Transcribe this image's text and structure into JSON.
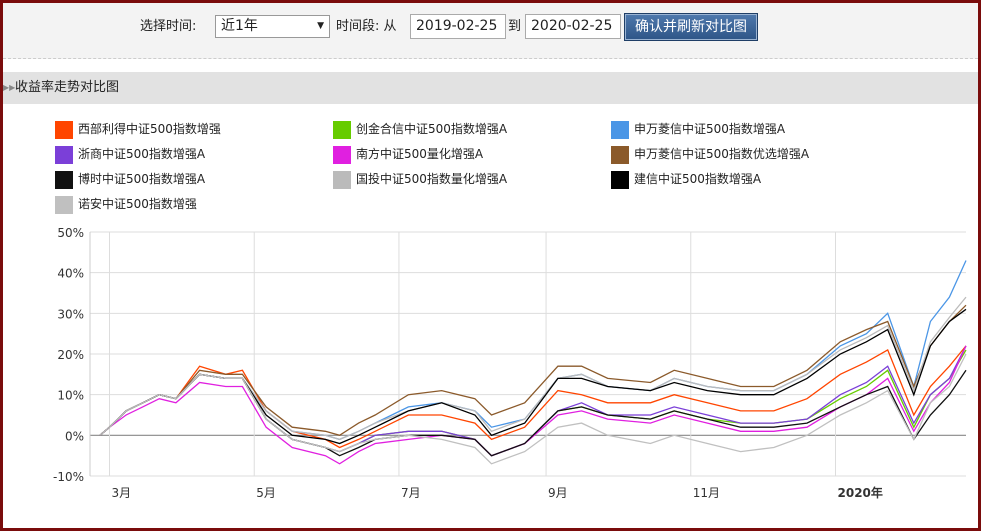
{
  "toolbar": {
    "select_time_label": "选择时间:",
    "range_value": "近1年",
    "period_label": "时间段: 从",
    "start_date": "2019-02-25",
    "to_label": "到",
    "end_date": "2020-02-25",
    "confirm_button": "确认并刷新对比图"
  },
  "section": {
    "title": "收益率走势对比图",
    "icon": "double-chevron-right-icon"
  },
  "chart_data": {
    "type": "line",
    "title": "",
    "xlabel": "",
    "ylabel": "",
    "ylim": [
      -10,
      50
    ],
    "y_ticks": [
      "50%",
      "40%",
      "30%",
      "20%",
      "10%",
      "0%",
      "-10%"
    ],
    "y_tick_values": [
      50,
      40,
      30,
      20,
      10,
      0,
      -10
    ],
    "x_ticks": [
      {
        "label": "3月",
        "date": "2019-03-01"
      },
      {
        "label": "5月",
        "date": "2019-05-01"
      },
      {
        "label": "7月",
        "date": "2019-07-01"
      },
      {
        "label": "9月",
        "date": "2019-09-01"
      },
      {
        "label": "11月",
        "date": "2019-11-01"
      },
      {
        "label": "2020年",
        "date": "2020-01-01",
        "bold": true
      }
    ],
    "xlim": [
      "2019-02-25",
      "2020-02-25"
    ],
    "grid": true,
    "legend_placement": "top",
    "dates": [
      "2019-02-25",
      "2019-03-01",
      "2019-03-08",
      "2019-03-15",
      "2019-03-22",
      "2019-03-29",
      "2019-04-08",
      "2019-04-19",
      "2019-04-26",
      "2019-05-06",
      "2019-05-17",
      "2019-05-31",
      "2019-06-06",
      "2019-06-14",
      "2019-06-21",
      "2019-07-05",
      "2019-07-19",
      "2019-08-02",
      "2019-08-09",
      "2019-08-23",
      "2019-09-06",
      "2019-09-16",
      "2019-09-27",
      "2019-10-15",
      "2019-10-25",
      "2019-11-08",
      "2019-11-22",
      "2019-12-06",
      "2019-12-20",
      "2020-01-03",
      "2020-01-14",
      "2020-01-23",
      "2020-02-03",
      "2020-02-10",
      "2020-02-18",
      "2020-02-25"
    ],
    "series": [
      {
        "name": "西部利得中证500指数增强",
        "color": "#ff4500",
        "values": [
          0,
          2,
          6,
          8,
          10,
          9,
          17,
          15,
          16,
          6,
          1,
          -1,
          -3,
          -1,
          1,
          5,
          5,
          3,
          -1,
          2,
          11,
          10,
          8,
          8,
          10,
          8,
          6,
          6,
          9,
          15,
          18,
          21,
          5,
          12,
          17,
          22
        ]
      },
      {
        "name": "创金合信中证500指数增强A",
        "color": "#66cc00",
        "values": [
          0,
          2,
          6,
          8,
          10,
          9,
          15,
          14,
          14,
          4,
          -1,
          -3,
          -4,
          -2,
          0,
          1,
          1,
          -1,
          -5,
          -2,
          6,
          7,
          5,
          4,
          6,
          4,
          3,
          3,
          4,
          9,
          12,
          16,
          2,
          10,
          14,
          21
        ]
      },
      {
        "name": "申万菱信中证500指数增强A",
        "color": "#4b96e6",
        "values": [
          0,
          2,
          6,
          8,
          10,
          9,
          15,
          14,
          14,
          6,
          1,
          0,
          -1,
          1,
          3,
          7,
          8,
          6,
          2,
          4,
          14,
          15,
          12,
          11,
          14,
          12,
          11,
          11,
          15,
          22,
          25,
          30,
          12,
          28,
          34,
          43
        ]
      },
      {
        "name": "浙商中证500指数增强A",
        "color": "#7b3fd8",
        "values": [
          0,
          2,
          6,
          8,
          10,
          9,
          15,
          14,
          14,
          4,
          -1,
          -3,
          -4,
          -2,
          0,
          1,
          1,
          -1,
          -5,
          -2,
          6,
          8,
          5,
          5,
          7,
          5,
          3,
          3,
          4,
          10,
          13,
          17,
          3,
          10,
          14,
          22
        ]
      },
      {
        "name": "南方中证500量化增强A",
        "color": "#e020e0",
        "values": [
          0,
          2,
          5,
          7,
          9,
          8,
          13,
          12,
          12,
          2,
          -3,
          -5,
          -7,
          -4,
          -2,
          -1,
          0,
          -1,
          -5,
          -2,
          5,
          6,
          4,
          3,
          5,
          3,
          1,
          1,
          2,
          7,
          10,
          14,
          1,
          8,
          13,
          22
        ]
      },
      {
        "name": "申万菱信中证500指数优选增强A",
        "color": "#8b5a2b",
        "values": [
          0,
          2,
          6,
          8,
          10,
          9,
          16,
          15,
          15,
          7,
          2,
          1,
          0,
          3,
          5,
          10,
          11,
          9,
          5,
          8,
          17,
          17,
          14,
          13,
          16,
          14,
          12,
          12,
          16,
          23,
          26,
          28,
          12,
          22,
          28,
          32
        ]
      },
      {
        "name": "博时中证500指数增强A",
        "color": "#111111",
        "values": [
          0,
          2,
          6,
          8,
          10,
          9,
          15,
          14,
          14,
          4,
          -1,
          -3,
          -5,
          -3,
          -1,
          0,
          0,
          -1,
          -5,
          -2,
          6,
          7,
          5,
          4,
          6,
          4,
          2,
          2,
          3,
          7,
          10,
          12,
          -1,
          5,
          10,
          16
        ]
      },
      {
        "name": "国投中证500指数量化增强A",
        "color": "#bbbbbb",
        "values": [
          0,
          2,
          6,
          8,
          10,
          9,
          15,
          14,
          14,
          6,
          1,
          0,
          -1,
          1,
          3,
          6,
          8,
          6,
          1,
          4,
          14,
          15,
          12,
          11,
          14,
          12,
          11,
          11,
          15,
          21,
          24,
          27,
          11,
          23,
          29,
          34
        ]
      },
      {
        "name": "建信中证500指数增强A",
        "color": "#000000",
        "values": [
          0,
          2,
          6,
          8,
          10,
          9,
          15,
          14,
          14,
          5,
          0,
          -1,
          -2,
          0,
          2,
          6,
          8,
          5,
          0,
          3,
          14,
          14,
          12,
          11,
          13,
          11,
          10,
          10,
          14,
          20,
          23,
          26,
          10,
          22,
          28,
          31
        ]
      },
      {
        "name": "诺安中证500指数增强",
        "color": "#c0c0c0",
        "values": [
          0,
          2,
          6,
          8,
          10,
          9,
          15,
          14,
          14,
          4,
          -1,
          -3,
          -4,
          -2,
          -1,
          0,
          -1,
          -3,
          -7,
          -4,
          2,
          3,
          0,
          -2,
          0,
          -2,
          -4,
          -3,
          0,
          5,
          8,
          11,
          -1,
          8,
          12,
          20
        ]
      }
    ]
  }
}
